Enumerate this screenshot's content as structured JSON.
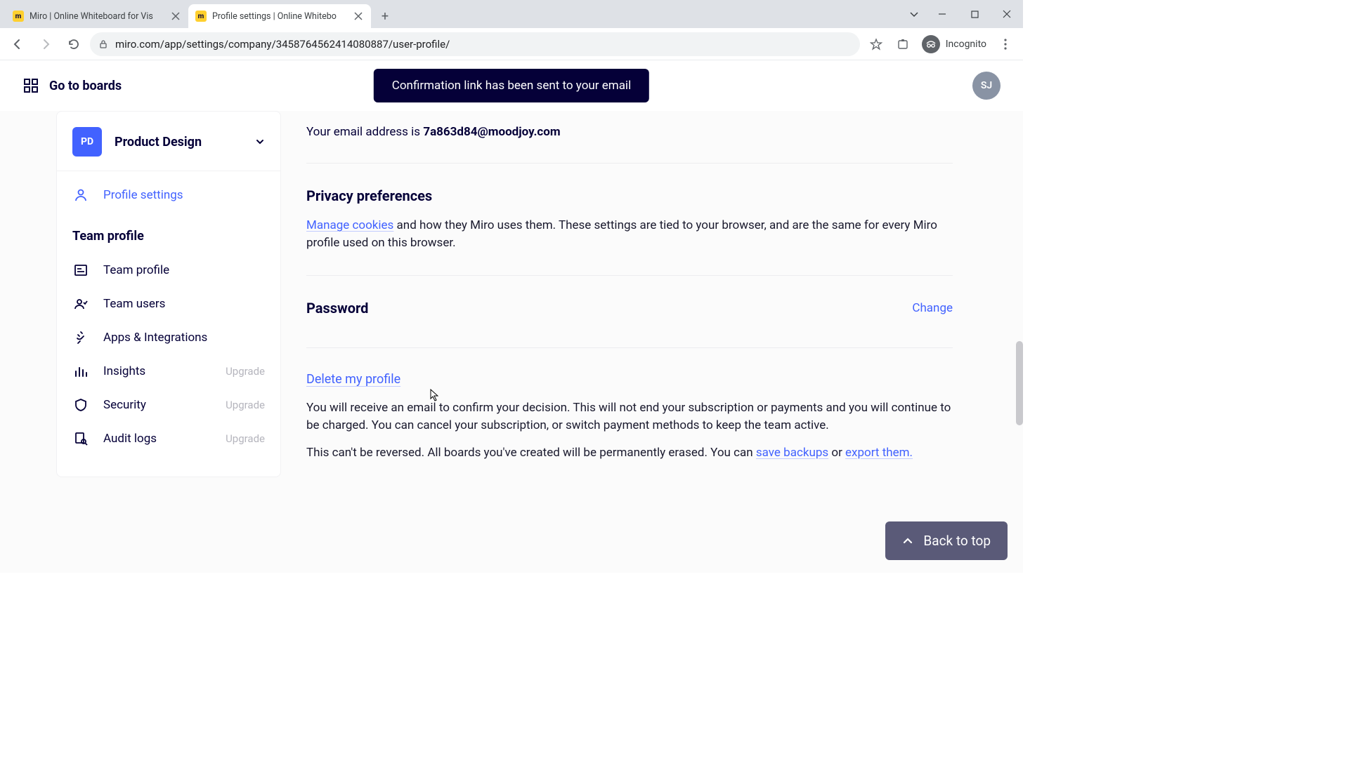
{
  "browser": {
    "tabs": [
      {
        "title": "Miro | Online Whiteboard for Vis"
      },
      {
        "title": "Profile settings | Online Whitebo"
      }
    ],
    "url": "miro.com/app/settings/company/3458764562414080887/user-profile/",
    "incognito_label": "Incognito"
  },
  "header": {
    "boards_link": "Go to boards",
    "avatar_initials": "SJ"
  },
  "toast": "Confirmation link has been sent to your email",
  "sidebar": {
    "team_badge": "PD",
    "team_name": "Product Design",
    "active_item": "Profile settings",
    "section_title": "Team profile",
    "items": [
      {
        "label": "Team profile",
        "upgrade": ""
      },
      {
        "label": "Team users",
        "upgrade": ""
      },
      {
        "label": "Apps & Integrations",
        "upgrade": ""
      },
      {
        "label": "Insights",
        "upgrade": "Upgrade"
      },
      {
        "label": "Security",
        "upgrade": "Upgrade"
      },
      {
        "label": "Audit logs",
        "upgrade": "Upgrade"
      }
    ]
  },
  "content": {
    "email_prefix": "Your email address is ",
    "email_value": "7a863d84@moodjoy.com",
    "privacy": {
      "title": "Privacy preferences",
      "link": "Manage cookies",
      "rest": " and how they Miro uses them. These settings are tied to your browser, and are the same for every Miro profile used on this browser."
    },
    "password": {
      "title": "Password",
      "action": "Change"
    },
    "delete": {
      "title": "Delete my profile",
      "p1": "You will receive an email to confirm your decision. This will not end your subscription or payments and you will continue to be charged. You can cancel your subscription, or switch payment methods to keep the team active.",
      "p2_a": "This can't be reversed. All boards you've created will be permanently erased. You can ",
      "p2_link1": "save backups",
      "p2_b": " or ",
      "p2_link2": "export them."
    }
  },
  "back_to_top": "Back to top"
}
